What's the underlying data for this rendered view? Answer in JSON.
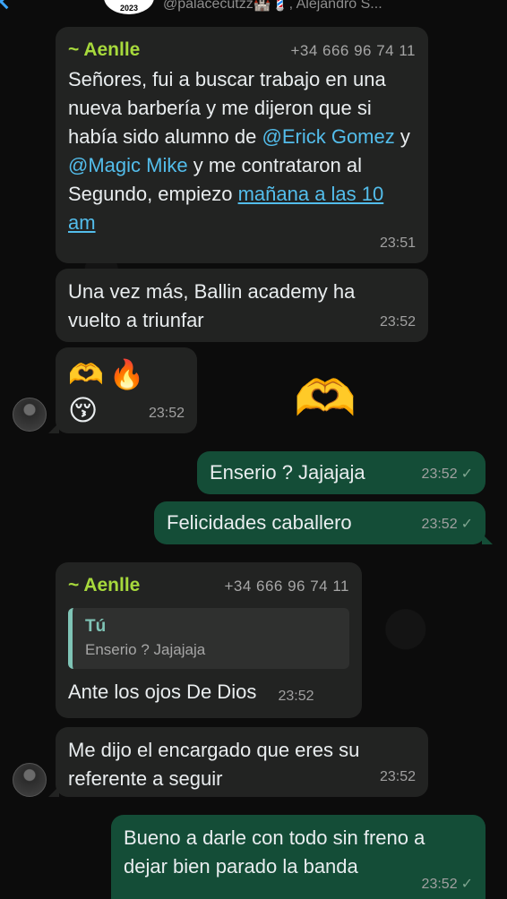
{
  "header": {
    "avatar_text": "2023",
    "subtitle": "@palacecutzz🏰💈, Alejandro S..."
  },
  "messages": [
    {
      "sender": "~ Aenlle",
      "phone": "+34 666 96 74 11",
      "text_1": "Señores, fui a buscar trabajo en una nueva barbería y me dijeron que si había sido alumno de ",
      "mention_1": "@Erick Gomez",
      "text_2": " y ",
      "mention_2": "@Magic Mike",
      "text_3": " y me contrataron al Segundo, empiezo ",
      "link": "mañana a las 10 am",
      "time": "23:51"
    },
    {
      "text": "Una vez más, Ballin academy ha vuelto a triunfar",
      "time": "23:52"
    },
    {
      "emojis": "🫶🔥😚",
      "time": "23:52",
      "sticker": "🫶"
    },
    {
      "text": "Enserio ? Jajajaja",
      "time": "23:52",
      "check": "✓"
    },
    {
      "text": "Felicidades caballero",
      "time": "23:52",
      "check": "✓"
    },
    {
      "sender": "~ Aenlle",
      "phone": "+34 666 96 74 11",
      "quote_author": "Tú",
      "quote_text": "Enserio ? Jajajaja",
      "text": "Ante los ojos De Dios",
      "time": "23:52"
    },
    {
      "text": "Me dijo el encargado que eres su referente a seguir",
      "time": "23:52"
    },
    {
      "text": "Bueno a darle con todo sin freno a dejar bien parado la banda",
      "time": "23:52",
      "check": "✓"
    }
  ]
}
